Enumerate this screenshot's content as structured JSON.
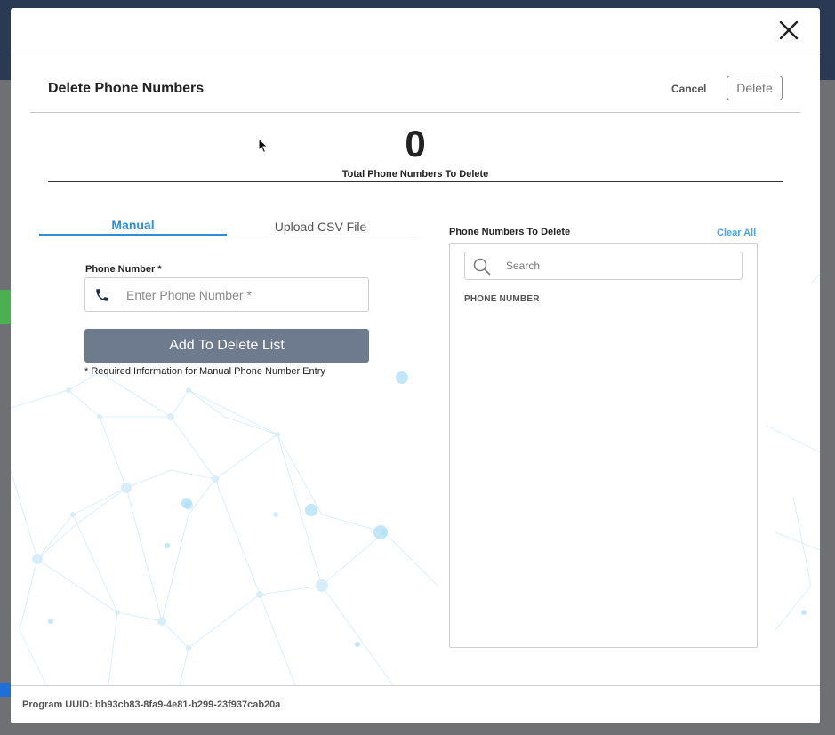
{
  "modal": {
    "title": "Delete Phone Numbers",
    "cancel_label": "Cancel",
    "delete_label": "Delete",
    "close_icon": "close-icon"
  },
  "summary": {
    "count": "0",
    "label": "Total Phone Numbers To Delete"
  },
  "tabs": [
    {
      "label": "Manual",
      "active": true
    },
    {
      "label": "Upload CSV File",
      "active": false
    }
  ],
  "manual": {
    "field_label": "Phone Number *",
    "field_placeholder": "Enter Phone Number *",
    "field_value": "",
    "field_icon": "phone-icon",
    "add_button_label": "Add To Delete List",
    "required_note": "* Required Information for Manual Phone Number Entry"
  },
  "delete_list": {
    "title": "Phone Numbers To Delete",
    "clear_all_label": "Clear All",
    "search_placeholder": "Search",
    "search_icon": "search-icon",
    "column_header": "PHONE NUMBER",
    "rows": []
  },
  "footer": {
    "uuid_text": "Program UUID: bb93cb83-8fa9-4e81-b299-23f937cab20a"
  },
  "colors": {
    "accent": "#2b8fdb",
    "link": "#4ba6e8",
    "add_button_bg": "#6e7a8d"
  }
}
